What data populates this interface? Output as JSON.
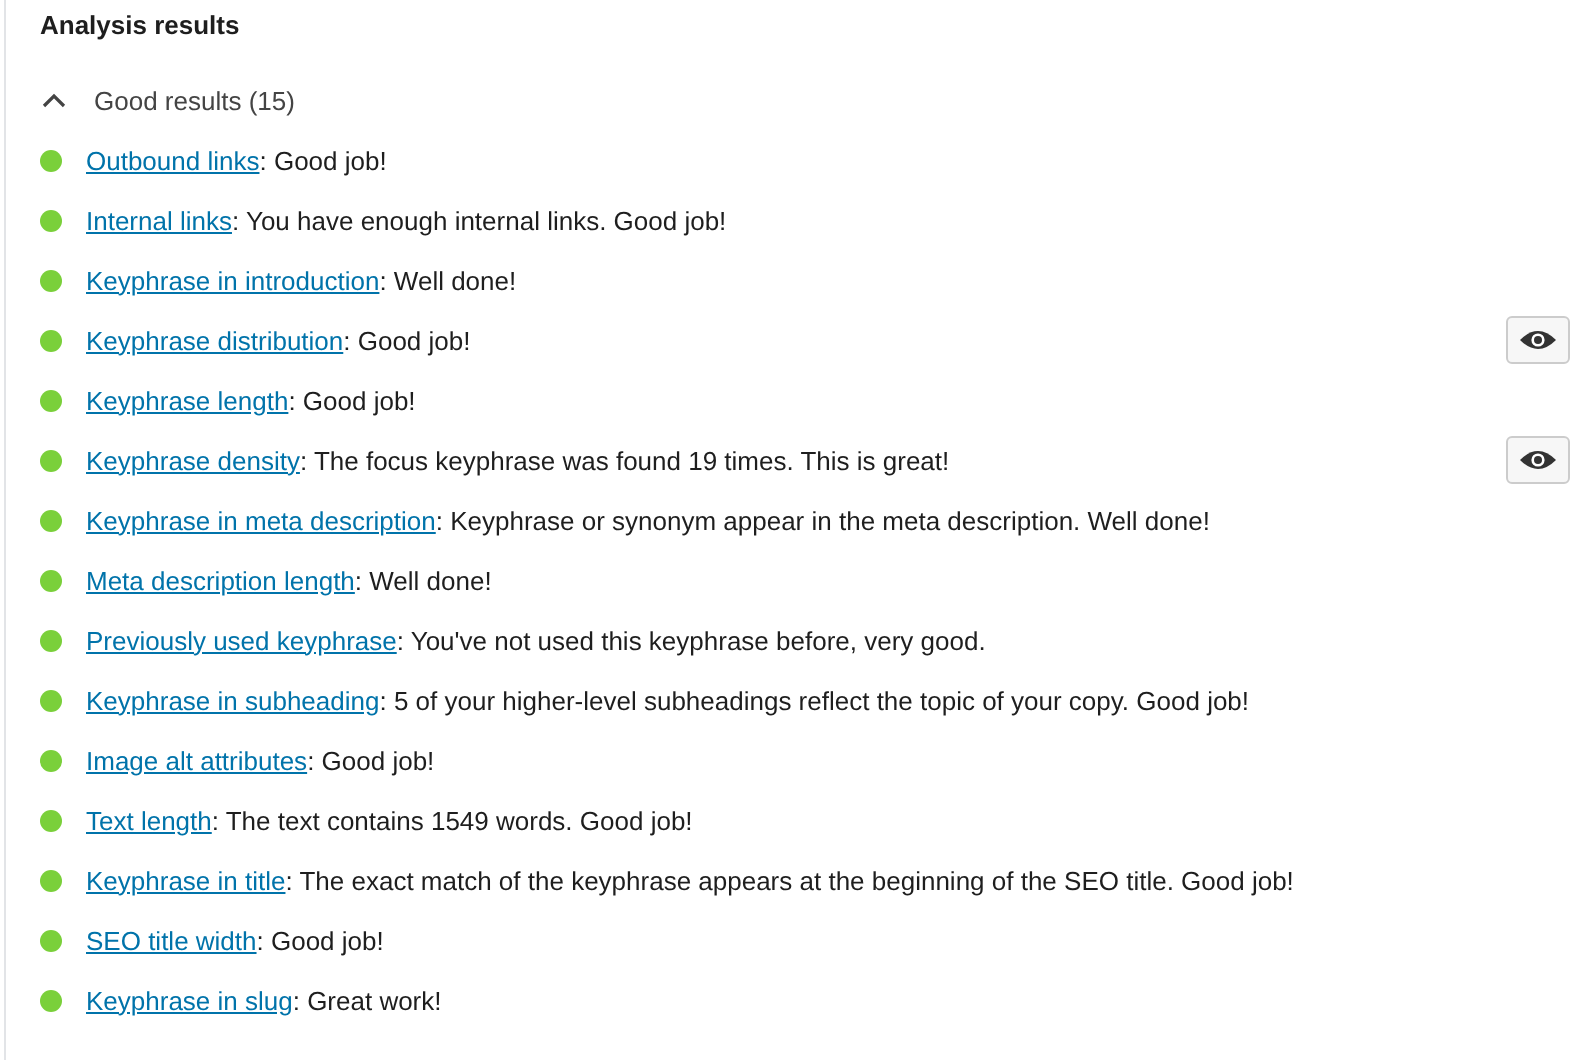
{
  "title": "Analysis results",
  "section": {
    "label": "Good results (15)",
    "expanded": true,
    "results": [
      {
        "link": "Outbound links",
        "text": ": Good job!",
        "color": "#7ad03a",
        "marker": false
      },
      {
        "link": "Internal links",
        "text": ": You have enough internal links. Good job!",
        "color": "#7ad03a",
        "marker": false
      },
      {
        "link": "Keyphrase in introduction",
        "text": ": Well done!",
        "color": "#7ad03a",
        "marker": false
      },
      {
        "link": "Keyphrase distribution",
        "text": ": Good job!",
        "color": "#7ad03a",
        "marker": true
      },
      {
        "link": "Keyphrase length",
        "text": ": Good job!",
        "color": "#7ad03a",
        "marker": false
      },
      {
        "link": "Keyphrase density",
        "text": ": The focus keyphrase was found 19 times. This is great!",
        "color": "#7ad03a",
        "marker": true
      },
      {
        "link": "Keyphrase in meta description",
        "text": ": Keyphrase or synonym appear in the meta description. Well done!",
        "color": "#7ad03a",
        "marker": false
      },
      {
        "link": "Meta description length",
        "text": ": Well done!",
        "color": "#7ad03a",
        "marker": false
      },
      {
        "link": "Previously used keyphrase",
        "text": ": You've not used this keyphrase before, very good.",
        "color": "#7ad03a",
        "marker": false
      },
      {
        "link": "Keyphrase in subheading",
        "text": ": 5 of your higher-level subheadings reflect the topic of your copy. Good job!",
        "color": "#7ad03a",
        "marker": false
      },
      {
        "link": "Image alt attributes",
        "text": ": Good job!",
        "color": "#7ad03a",
        "marker": false
      },
      {
        "link": "Text length",
        "text": ": The text contains 1549 words. Good job!",
        "color": "#7ad03a",
        "marker": false
      },
      {
        "link": "Keyphrase in title",
        "text": ": The exact match of the keyphrase appears at the beginning of the SEO title. Good job!",
        "color": "#7ad03a",
        "marker": false
      },
      {
        "link": "SEO title width",
        "text": ": Good job!",
        "color": "#7ad03a",
        "marker": false
      },
      {
        "link": "Keyphrase in slug",
        "text": ": Great work!",
        "color": "#7ad03a",
        "marker": false
      }
    ]
  }
}
